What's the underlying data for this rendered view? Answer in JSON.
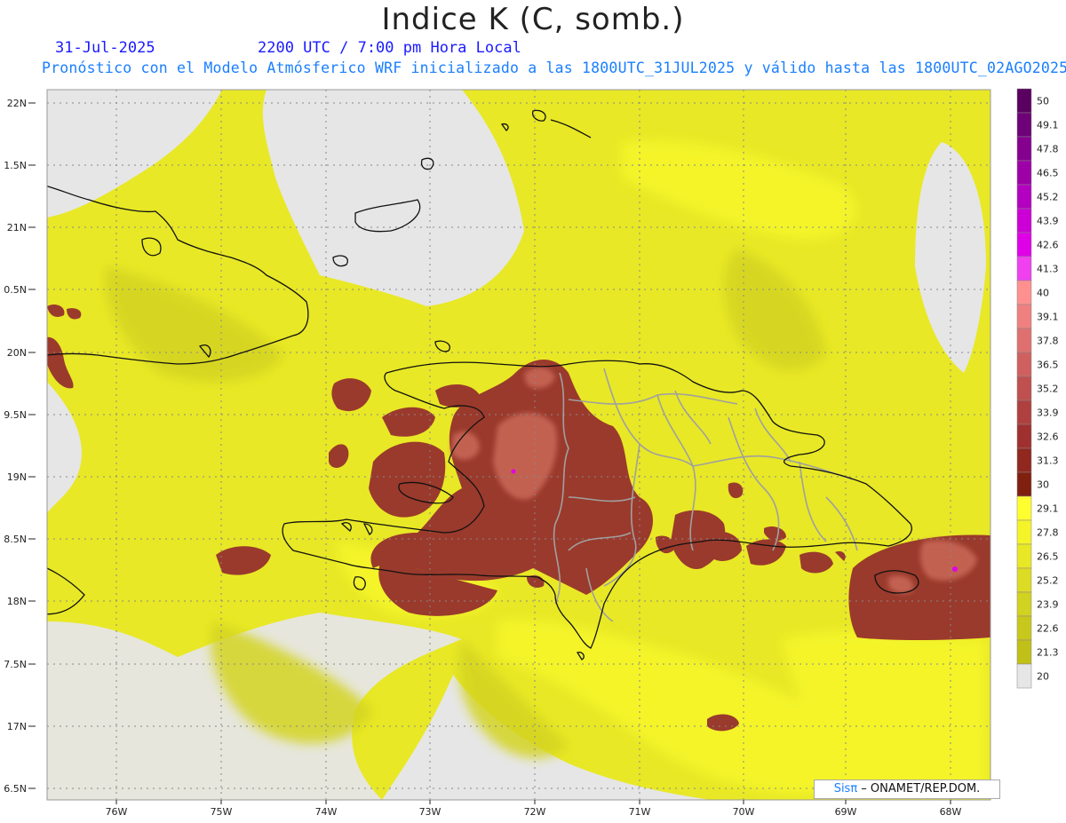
{
  "header": {
    "title": "Indice K (C, somb.)",
    "date": "31-Jul-2025",
    "time": "2200 UTC / 7:00 pm Hora Local",
    "subtitle": "Pronóstico con el Modelo Atmósferico WRF inicializado a las 1800UTC_31JUL2025 y válido hasta las  1800UTC_02AGO2025"
  },
  "axes": {
    "lat_labels": [
      "22N",
      "1.5N",
      "21N",
      "0.5N",
      "20N",
      "9.5N",
      "19N",
      "8.5N",
      "18N",
      "7.5N",
      "17N",
      "6.5N"
    ],
    "lon_labels": [
      "76W",
      "75W",
      "74W",
      "73W",
      "72W",
      "71W",
      "70W",
      "69W",
      "68W"
    ]
  },
  "colorbar": {
    "labels": [
      "50",
      "49.1",
      "47.8",
      "46.5",
      "45.2",
      "43.9",
      "42.6",
      "41.3",
      "40",
      "39.1",
      "37.8",
      "36.5",
      "35.2",
      "33.9",
      "32.6",
      "31.3",
      "30",
      "29.1",
      "27.8",
      "26.5",
      "25.2",
      "23.9",
      "22.6",
      "21.3",
      "20"
    ],
    "colors": [
      "#5a0060",
      "#6e0078",
      "#860090",
      "#9e00a8",
      "#b400c0",
      "#cc00d6",
      "#e000e8",
      "#f040f0",
      "#ff9090",
      "#f08080",
      "#e07070",
      "#d06060",
      "#c05050",
      "#b04040",
      "#a03030",
      "#902820",
      "#802010",
      "#ffff30",
      "#f4f428",
      "#e8e826",
      "#dcdc24",
      "#d2d220",
      "#c8c81c",
      "#c0c018",
      "#e6e6e6"
    ]
  },
  "credit": {
    "brand": "Sisπ",
    "text": " – ONAMET/REP.DOM."
  },
  "colors": {
    "background_field": "#e8e826",
    "no_data": "#e6e6e6",
    "high_k": "#9a3a2c",
    "high_k_light": "#c05a4a",
    "coast": "#111111",
    "provinces": "#999999"
  }
}
